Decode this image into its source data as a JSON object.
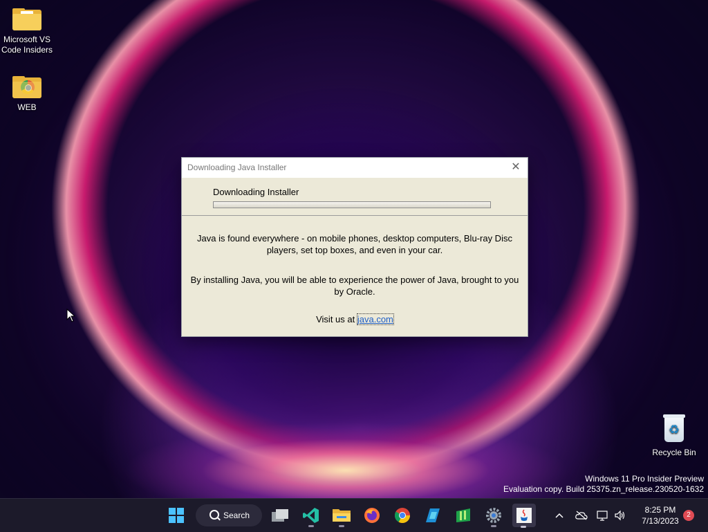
{
  "desktop": {
    "icons": [
      {
        "label": "Microsoft VS\nCode Insiders"
      },
      {
        "label": "WEB"
      },
      {
        "label": "Recycle Bin"
      }
    ],
    "watermark": {
      "line1": "Windows 11 Pro Insider Preview",
      "line2": "Evaluation copy. Build 25375.zn_release.230520-1632"
    }
  },
  "dialog": {
    "title": "Downloading Java Installer",
    "status": "Downloading Installer",
    "progress_percent": 0,
    "paragraph1": "Java is found everywhere - on mobile phones, desktop computers, Blu-ray Disc players, set top boxes, and even in your car.",
    "paragraph2": "By installing Java, you will be able to experience the power of Java, brought to you by Oracle.",
    "visit_prefix": "Visit us at",
    "visit_link": "java.com"
  },
  "taskbar": {
    "search_label": "Search",
    "time": "8:25 PM",
    "date": "7/13/2023",
    "notification_count": "2",
    "apps": [
      "start-icon",
      "task-view-icon",
      "vscode-insiders-icon",
      "file-explorer-icon",
      "firefox-icon",
      "chrome-icon",
      "azure-data-studio-icon",
      "excel-like-icon",
      "settings-icon",
      "java-icon"
    ]
  }
}
